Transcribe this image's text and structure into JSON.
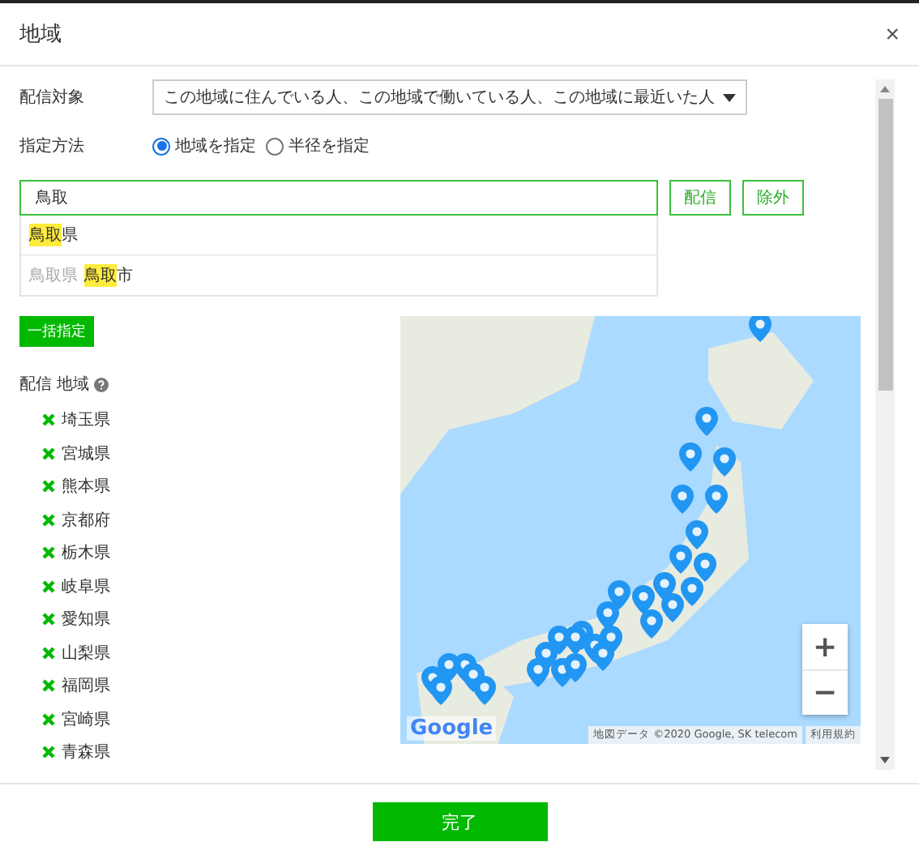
{
  "dialog": {
    "title": "地域",
    "close": "×"
  },
  "target": {
    "label": "配信対象",
    "value": "この地域に住んでいる人、この地域で働いている人、この地域に最近いた人"
  },
  "method": {
    "label": "指定方法",
    "options": [
      {
        "label": "地域を指定",
        "selected": true
      },
      {
        "label": "半径を指定",
        "selected": false
      }
    ]
  },
  "search": {
    "value": "鳥取",
    "buttons": [
      "配信",
      "除外"
    ],
    "suggestions": [
      {
        "match": "鳥取",
        "rest": "県"
      },
      {
        "context": "鳥取県",
        "match": "鳥取",
        "rest": "市"
      }
    ]
  },
  "bulk_button": "一括指定",
  "regions": {
    "heading": "配信 地域",
    "items": [
      "埼玉県",
      "宮城県",
      "熊本県",
      "京都府",
      "栃木県",
      "岐阜県",
      "愛知県",
      "山梨県",
      "福岡県",
      "宮崎県",
      "青森県"
    ]
  },
  "map": {
    "logo": "Google",
    "attribution": "地図データ ©2020 Google, SK telecom",
    "terms": "利用規約",
    "zoom_in": "+",
    "zoom_out": "−"
  },
  "footer": {
    "button": "完了"
  }
}
